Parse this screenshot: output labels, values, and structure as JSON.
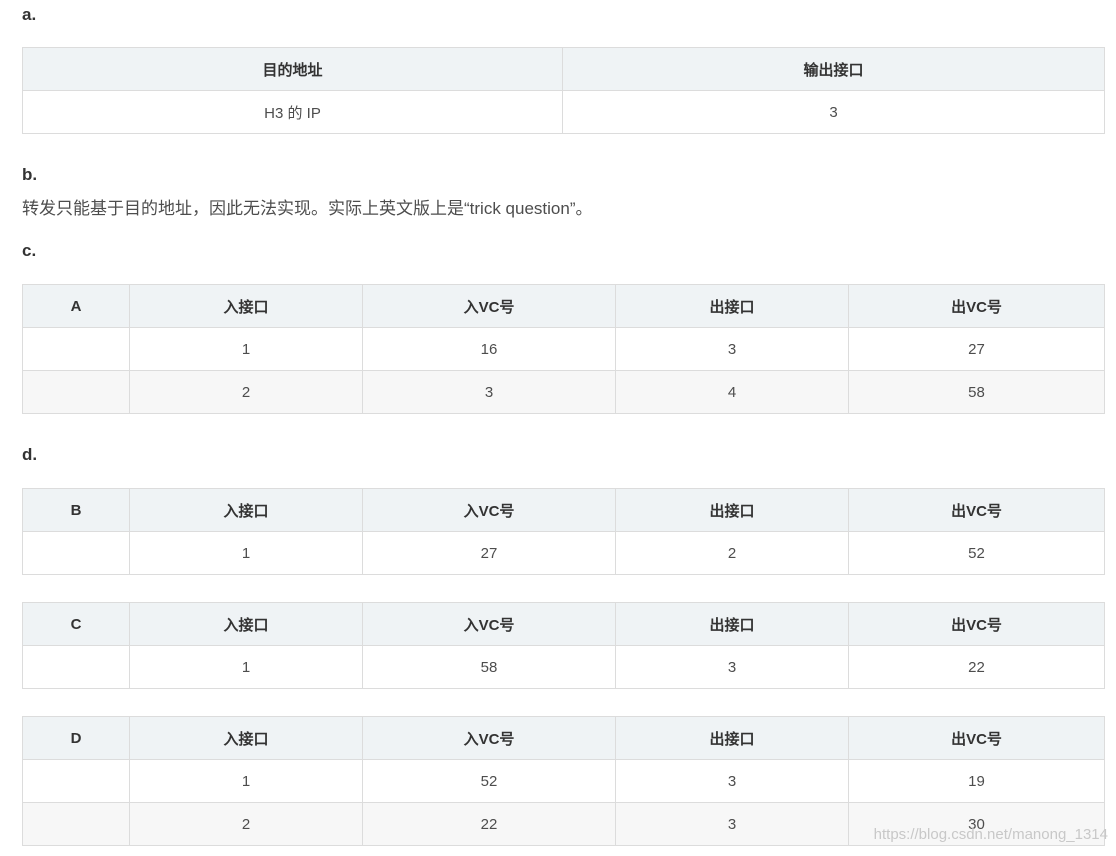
{
  "part_a": {
    "label": "a.",
    "headers": [
      "目的地址",
      "输出接口"
    ],
    "rows": [
      [
        "H3 的 IP",
        "3"
      ]
    ]
  },
  "part_b": {
    "label": "b.",
    "text": "转发只能基于目的地址，因此无法实现。实际上英文版上是“trick question”。"
  },
  "part_c": {
    "label": "c.",
    "table": {
      "headers": [
        "A",
        "入接口",
        "入VC号",
        "出接口",
        "出VC号"
      ],
      "rows": [
        [
          "",
          "1",
          "16",
          "3",
          "27"
        ],
        [
          "",
          "2",
          "3",
          "4",
          "58"
        ]
      ]
    }
  },
  "part_d": {
    "label": "d.",
    "tables": [
      {
        "headers": [
          "B",
          "入接口",
          "入VC号",
          "出接口",
          "出VC号"
        ],
        "rows": [
          [
            "",
            "1",
            "27",
            "2",
            "52"
          ]
        ]
      },
      {
        "headers": [
          "C",
          "入接口",
          "入VC号",
          "出接口",
          "出VC号"
        ],
        "rows": [
          [
            "",
            "1",
            "58",
            "3",
            "22"
          ]
        ]
      },
      {
        "headers": [
          "D",
          "入接口",
          "入VC号",
          "出接口",
          "出VC号"
        ],
        "rows": [
          [
            "",
            "1",
            "52",
            "3",
            "19"
          ],
          [
            "",
            "2",
            "22",
            "3",
            "30"
          ]
        ]
      }
    ]
  },
  "watermark": "https://blog.csdn.net/manong_1314"
}
